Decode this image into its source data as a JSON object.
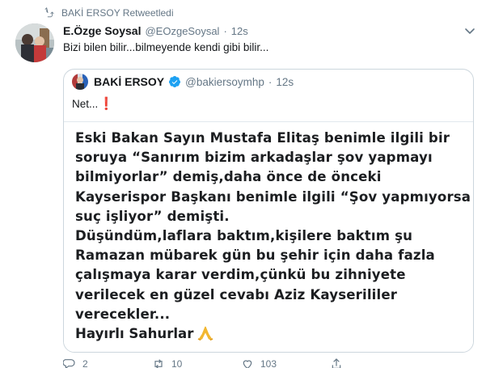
{
  "retweet": {
    "icon": "retweet-icon",
    "label": "BAKİ ERSOY Retweetledi"
  },
  "tweet": {
    "author_name": "E.Özge Soysal",
    "handle": "@EOzgeSoysal",
    "separator": "·",
    "time": "12s",
    "text": "Bizi bilen bilir...bilmeyende kendi gibi bilir..."
  },
  "quoted": {
    "author_name": "BAKİ ERSOY",
    "handle": "@bakiersoymhp",
    "separator": "·",
    "time": "12s",
    "text": "Net...",
    "image_lines": [
      "Eski Bakan Sayın Mustafa Elitaş benimle ilgili bir",
      "soruya “Sanırım bizim arkadaşlar şov yapmayı",
      "bilmiyorlar” demiş,daha önce de önceki",
      "Kayserispor Başkanı benimle ilgili “Şov yapmıyorsa",
      "suç işliyor” demişti.",
      "Düşündüm,laflara baktım,kişilere baktım şu",
      "Ramazan mübarek gün bu şehir için daha fazla",
      "çalışmaya karar verdim,çünkü bu zihniyete",
      "verilecek en güzel cevabı Aziz Kayserililer",
      "verecekler..."
    ],
    "image_closing": "Hayırlı Sahurlar"
  },
  "actions": {
    "reply_count": "2",
    "retweet_count": "10",
    "like_count": "103"
  },
  "colors": {
    "accent": "#1da1f2",
    "muted": "#657786",
    "border": "#ccd6dd",
    "alert": "#d0021b"
  }
}
